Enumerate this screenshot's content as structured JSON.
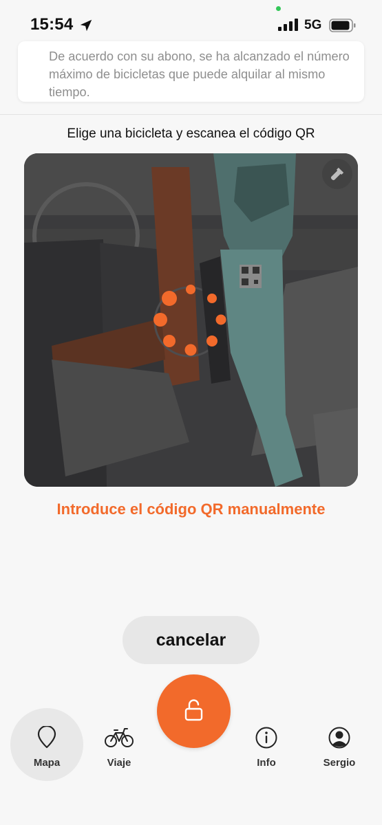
{
  "status_bar": {
    "time": "15:54",
    "network": "5G",
    "location_icon": "location-arrow-icon",
    "signal_icon": "cellular-signal-icon",
    "battery_icon": "battery-icon"
  },
  "notice": {
    "text": "De acuerdo con su abono, se ha alcanzado el número máximo de bicicletas que puede alquilar al mismo tiempo."
  },
  "scanner": {
    "instruction": "Elige una bicicleta y escanea el código QR",
    "torch_icon": "flashlight-icon",
    "loading_icon": "loading-spinner-icon",
    "manual_link": "Introduce el código QR manualmente"
  },
  "actions": {
    "cancel_label": "cancelar"
  },
  "unlock_button": {
    "icon": "unlock-icon"
  },
  "tab_bar": {
    "items": [
      {
        "label": "Mapa",
        "icon": "map-pin-icon",
        "active": true
      },
      {
        "label": "Viaje",
        "icon": "bicycle-icon",
        "active": false
      },
      {
        "label": "Info",
        "icon": "info-icon",
        "active": false
      },
      {
        "label": "Sergio",
        "icon": "profile-icon",
        "active": false
      }
    ]
  },
  "colors": {
    "accent": "#f26a2b",
    "background": "#f7f7f7",
    "notice_text": "#8e8e8e"
  }
}
